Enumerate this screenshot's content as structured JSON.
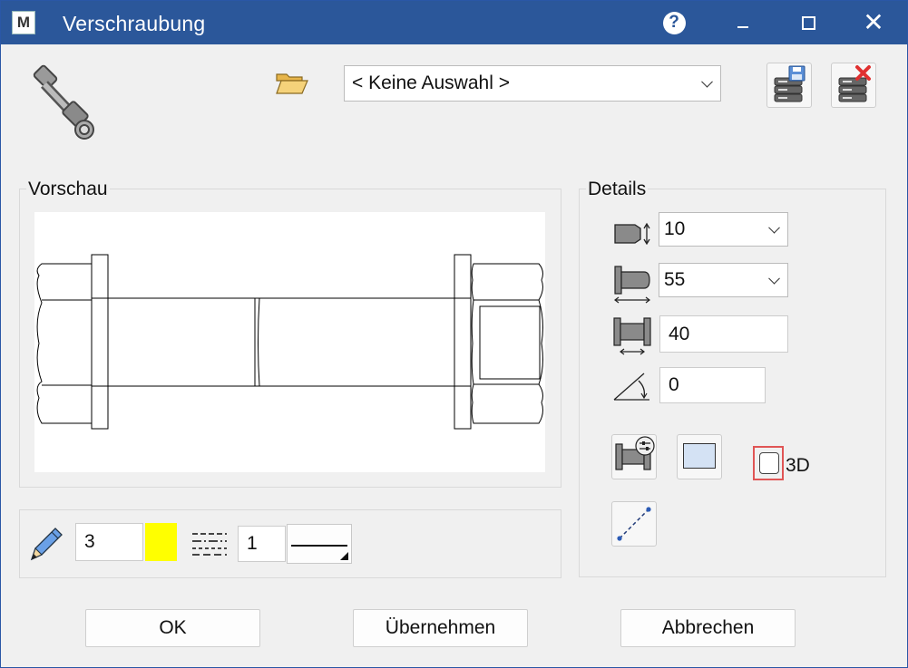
{
  "window": {
    "title": "Verschraubung",
    "app_icon": "M"
  },
  "titlebar": {
    "help_icon": "?",
    "close_glyph": "✕"
  },
  "toolbar": {
    "selection": "< Keine Auswahl >"
  },
  "preview": {
    "label": "Vorschau"
  },
  "details": {
    "label": "Details",
    "diameter": "10",
    "length": "55",
    "clamp_length": "40",
    "angle": "0",
    "checkbox_3d_label": "3D",
    "checkbox_3d_checked": false
  },
  "style_bar": {
    "pen_width": "3",
    "color": "#ffff00",
    "line_type": "1"
  },
  "buttons": {
    "ok": "OK",
    "apply": "Übernehmen",
    "cancel": "Abbrechen"
  }
}
